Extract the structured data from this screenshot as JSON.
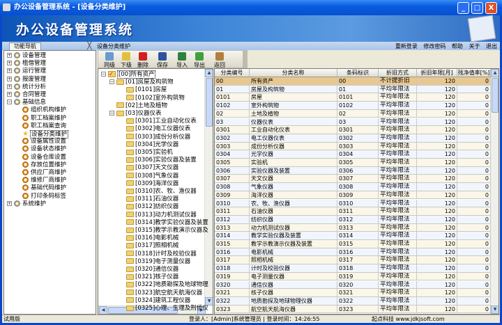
{
  "window": {
    "title": "办公设备管理系统 - [设备分类维护]",
    "minimize": "_",
    "maximize": "□",
    "close": "X"
  },
  "banner": {
    "title": "办公设备管理系统"
  },
  "tabs": {
    "nav_tab": "功能导航",
    "doc_tab": "设备分类维护",
    "close": "╳"
  },
  "top_links": [
    "重新登录",
    "修改密码",
    "帮助",
    "关于",
    "退出"
  ],
  "nav": {
    "groups": [
      "设备管理",
      "租借管理",
      "运行管理",
      "报废管理",
      "统计分析",
      "合同管理"
    ],
    "expanded": "基础信息",
    "children": [
      "组织机构维护",
      "职工档案维护",
      "职工档案查询",
      "设备分类维护",
      "设备属性设置",
      "设备状态维护",
      "设备仓库设置",
      "存放位置维护",
      "供应厂商维护",
      "维修厂商维护",
      "基础代码维护",
      "打印条码标签"
    ],
    "selected_index": 3,
    "last": "系统维护"
  },
  "toolbar": [
    "同级",
    "下级",
    "删除",
    "保存",
    "导入",
    "导出",
    "返回"
  ],
  "tree": [
    {
      "label": "[00]所有资产",
      "level": 0
    },
    {
      "label": "[01]房屋及构筑物",
      "level": 1
    },
    {
      "label": "[0101]房屋",
      "level": 2
    },
    {
      "label": "[0102]室外构筑物",
      "level": 2
    },
    {
      "label": "[02]土地及植物",
      "level": 1
    },
    {
      "label": "[03]仪器仪表",
      "level": 1
    },
    {
      "label": "[0301]工业自动化仪表",
      "level": 2
    },
    {
      "label": "[0302]电工仪器仪表",
      "level": 2
    },
    {
      "label": "[0303]成份分析仪器",
      "level": 2
    },
    {
      "label": "[0304]光学仪器",
      "level": 2
    },
    {
      "label": "[0305]实验机",
      "level": 2
    },
    {
      "label": "[0306]实验仪器及装置",
      "level": 2
    },
    {
      "label": "[0307]天文仪器",
      "level": 2
    },
    {
      "label": "[0308]气象仪器",
      "level": 2
    },
    {
      "label": "[0309]海洋仪器",
      "level": 2
    },
    {
      "label": "[0310]农、牧、渔仪器",
      "level": 2
    },
    {
      "label": "[0311]石油仪器",
      "level": 2
    },
    {
      "label": "[0312]纺织仪器",
      "level": 2
    },
    {
      "label": "[0313]动力机测试仪器",
      "level": 2
    },
    {
      "label": "[0314]教学实验仪器及装置",
      "level": 2
    },
    {
      "label": "[0315]教学示教演示仪器及",
      "level": 2
    },
    {
      "label": "[0316]电影机械",
      "level": 2
    },
    {
      "label": "[0317]照相机械",
      "level": 2
    },
    {
      "label": "[0318]计时及校验仪器",
      "level": 2
    },
    {
      "label": "[0319]电子测量仪器",
      "level": 2
    },
    {
      "label": "[0320]通信仪器",
      "level": 2
    },
    {
      "label": "[0321]核子仪器",
      "level": 2
    },
    {
      "label": "[0322]地质勘探及地球物理",
      "level": 2
    },
    {
      "label": "[0323]航空航天航海仪器",
      "level": 2
    },
    {
      "label": "[0324]建筑工程仪器",
      "level": 2
    },
    {
      "label": "[0325]心理、生理及刑侦仪",
      "level": 2
    }
  ],
  "grid": {
    "columns": [
      "分类编号",
      "分类名称",
      "条码标识",
      "折旧方式",
      "折旧年限[月]",
      "残净值率[%]"
    ],
    "rows": [
      [
        "00",
        "所有资产",
        "00",
        "不计提折旧",
        "120",
        "0"
      ],
      [
        "01",
        "房屋及构筑物",
        "01",
        "平均年限法",
        "120",
        "0"
      ],
      [
        "0101",
        "房屋",
        "0101",
        "平均年限法",
        "120",
        "0"
      ],
      [
        "0102",
        "室外构筑物",
        "0102",
        "平均年限法",
        "120",
        "0"
      ],
      [
        "02",
        "土地及植物",
        "02",
        "平均年限法",
        "120",
        "0"
      ],
      [
        "03",
        "仪器仪表",
        "03",
        "平均年限法",
        "120",
        "0"
      ],
      [
        "0301",
        "工业自动化仪表",
        "0301",
        "平均年限法",
        "120",
        "0"
      ],
      [
        "0302",
        "电工仪器仪表",
        "0302",
        "平均年限法",
        "120",
        "0"
      ],
      [
        "0303",
        "成份分析仪器",
        "0303",
        "平均年限法",
        "120",
        "0"
      ],
      [
        "0304",
        "光学仪器",
        "0304",
        "平均年限法",
        "120",
        "0"
      ],
      [
        "0305",
        "实验机",
        "0305",
        "平均年限法",
        "120",
        "0"
      ],
      [
        "0306",
        "实验仪器及装置",
        "0306",
        "平均年限法",
        "120",
        "0"
      ],
      [
        "0307",
        "天文仪器",
        "0307",
        "平均年限法",
        "120",
        "0"
      ],
      [
        "0308",
        "气象仪器",
        "0308",
        "平均年限法",
        "120",
        "0"
      ],
      [
        "0309",
        "海洋仪器",
        "0309",
        "平均年限法",
        "120",
        "0"
      ],
      [
        "0310",
        "农、牧、渔仪器",
        "0310",
        "平均年限法",
        "120",
        "0"
      ],
      [
        "0311",
        "石油仪器",
        "0311",
        "平均年限法",
        "120",
        "0"
      ],
      [
        "0312",
        "纺织仪器",
        "0312",
        "平均年限法",
        "120",
        "0"
      ],
      [
        "0313",
        "动力机测试仪器",
        "0313",
        "平均年限法",
        "120",
        "0"
      ],
      [
        "0314",
        "教学实验仪器及装置",
        "0314",
        "平均年限法",
        "120",
        "0"
      ],
      [
        "0315",
        "教学示教演示仪器及装置",
        "0315",
        "平均年限法",
        "120",
        "0"
      ],
      [
        "0316",
        "电影机械",
        "0316",
        "平均年限法",
        "120",
        "0"
      ],
      [
        "0317",
        "照相机械",
        "0317",
        "平均年限法",
        "120",
        "0"
      ],
      [
        "0318",
        "计时及校验仪器",
        "0318",
        "平均年限法",
        "120",
        "0"
      ],
      [
        "0319",
        "电子测量仪器",
        "0319",
        "平均年限法",
        "120",
        "0"
      ],
      [
        "0320",
        "通信仪器",
        "0320",
        "平均年限法",
        "120",
        "0"
      ],
      [
        "0321",
        "核子仪器",
        "0321",
        "平均年限法",
        "120",
        "0"
      ],
      [
        "0322",
        "地质勘探及地球物理仪器",
        "0322",
        "平均年限法",
        "120",
        "0"
      ],
      [
        "0323",
        "航空航天航海仪器",
        "0323",
        "平均年限法",
        "120",
        "0"
      ]
    ]
  },
  "status": {
    "edition": "试用版",
    "login": "登录人：[Admin]系统管理员 | 登录时间：14:26:55",
    "company": "起点科技 www.jdkjsoft.com"
  },
  "colors": {
    "selected_row": "#e8c890",
    "row_alt_a": "#f0f6fc",
    "row_alt_b": "#faf6e8",
    "title_blue": "#0a5ce0"
  }
}
